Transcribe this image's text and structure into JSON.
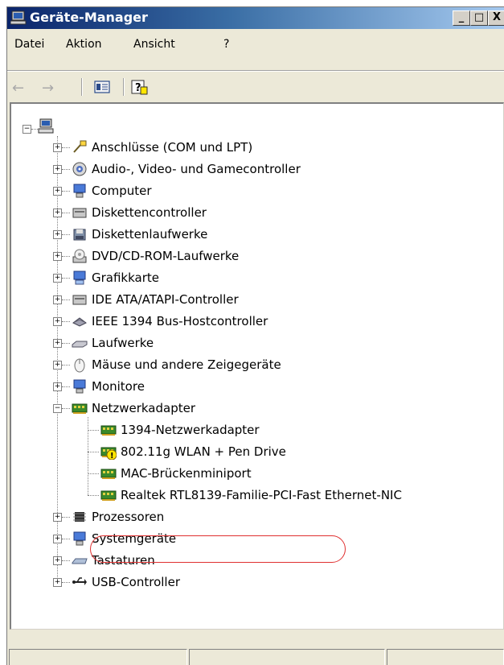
{
  "window": {
    "title": "Geräte-Manager",
    "title_icon": "device-manager-icon",
    "controls": {
      "minimize": "_",
      "maximize": "□",
      "close": "X"
    }
  },
  "menu": {
    "file": "Datei",
    "action": "Aktion",
    "view": "Ansicht",
    "help": "?"
  },
  "toolbar": {
    "back_icon": "arrow-left-icon",
    "forward_icon": "arrow-right-icon",
    "properties_icon": "properties-icon",
    "help_icon": "help-icon",
    "back": "←",
    "forward": "→"
  },
  "tree": {
    "root_icon": "computer-icon",
    "categories": [
      {
        "label": "Anschlüsse (COM und LPT)",
        "icon": "port-icon",
        "expanded": false
      },
      {
        "label": "Audio-, Video- und Gamecontroller",
        "icon": "audio-icon",
        "expanded": false
      },
      {
        "label": "Computer",
        "icon": "computer-icon",
        "expanded": false
      },
      {
        "label": "Diskettencontroller",
        "icon": "floppy-controller-icon",
        "expanded": false
      },
      {
        "label": "Diskettenlaufwerke",
        "icon": "floppy-drive-icon",
        "expanded": false
      },
      {
        "label": "DVD/CD-ROM-Laufwerke",
        "icon": "cdrom-icon",
        "expanded": false
      },
      {
        "label": "Grafikkarte",
        "icon": "display-adapter-icon",
        "expanded": false
      },
      {
        "label": "IDE ATA/ATAPI-Controller",
        "icon": "ide-controller-icon",
        "expanded": false
      },
      {
        "label": "IEEE 1394 Bus-Hostcontroller",
        "icon": "firewire-icon",
        "expanded": false
      },
      {
        "label": "Laufwerke",
        "icon": "disk-drive-icon",
        "expanded": false
      },
      {
        "label": "Mäuse und andere Zeigegeräte",
        "icon": "mouse-icon",
        "expanded": false
      },
      {
        "label": "Monitore",
        "icon": "monitor-icon",
        "expanded": false
      },
      {
        "label": "Netzwerkadapter",
        "icon": "network-adapter-icon",
        "expanded": true
      },
      {
        "label": "Prozessoren",
        "icon": "processor-icon",
        "expanded": false
      },
      {
        "label": "Systemgeräte",
        "icon": "system-device-icon",
        "expanded": false
      },
      {
        "label": "Tastaturen",
        "icon": "keyboard-icon",
        "expanded": false
      },
      {
        "label": "USB-Controller",
        "icon": "usb-icon",
        "expanded": false
      }
    ],
    "network_children": [
      {
        "label": "1394-Netzwerkadapter",
        "icon": "network-adapter-icon",
        "warning": false
      },
      {
        "label": "802.11g WLAN + Pen Drive",
        "icon": "network-adapter-icon",
        "warning": true
      },
      {
        "label": "MAC-Brückenminiport",
        "icon": "network-adapter-icon",
        "warning": false
      },
      {
        "label": "Realtek RTL8139-Familie-PCI-Fast Ethernet-NIC",
        "icon": "network-adapter-icon",
        "warning": false
      }
    ],
    "expand_glyph": "+",
    "collapse_glyph": "−"
  },
  "colors": {
    "title_gradient_start": "#0A246A",
    "title_gradient_end": "#A6CAF0",
    "highlight_ring": "#E03030",
    "warning_yellow": "#FFE600"
  }
}
